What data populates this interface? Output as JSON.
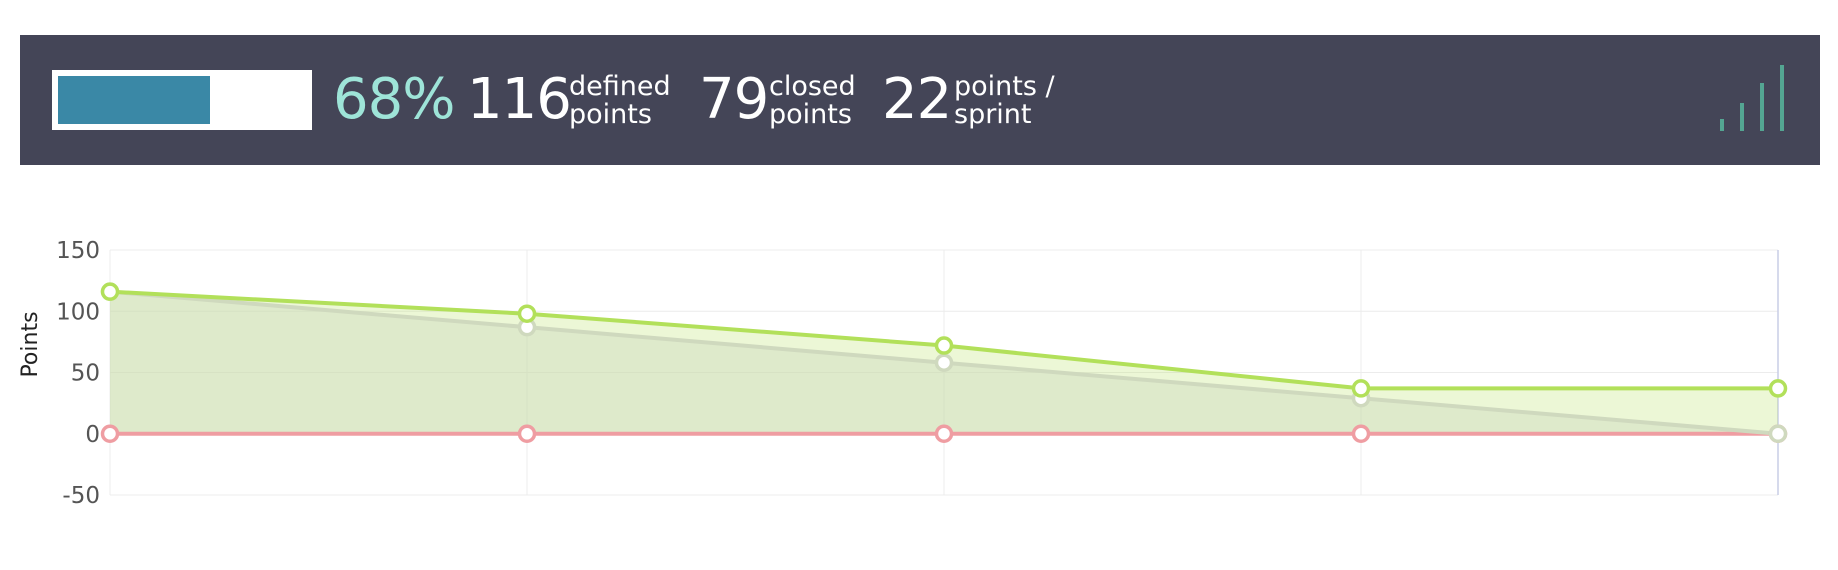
{
  "summary": {
    "progress": 0.68,
    "percent_text": "68%",
    "defined": {
      "value": "116",
      "label_line1": "defined",
      "label_line2": "points"
    },
    "closed": {
      "value": "79",
      "label_line1": "closed",
      "label_line2": "points"
    },
    "velocity": {
      "value": "22",
      "label_line1": "points /",
      "label_line2": "sprint"
    },
    "mini_bars": [
      0.18,
      0.42,
      0.72,
      1.0
    ],
    "colors": {
      "bar_bg": "#444557",
      "progress_fill": "#3a88a6",
      "percent": "#9ee4d8",
      "mini_bar": "#54a592"
    }
  },
  "chart_data": {
    "type": "area",
    "title": "",
    "xlabel": "",
    "ylabel": "Points",
    "ylim": [
      -50,
      150
    ],
    "yticks": [
      150,
      100,
      50,
      0,
      -50
    ],
    "x": [
      0,
      1,
      2,
      3,
      4
    ],
    "grid": true,
    "series": [
      {
        "values": [
          116,
          98,
          72,
          37,
          37
        ],
        "color": "#b2e05a",
        "type": "area",
        "markers": true
      },
      {
        "values": [
          116,
          87,
          58,
          29,
          0
        ],
        "color": "#cfd9be",
        "type": "area",
        "markers": true
      },
      {
        "values": [
          0,
          0,
          0,
          0,
          0
        ],
        "color": "#ef9da2",
        "type": "line",
        "markers": true
      }
    ]
  }
}
